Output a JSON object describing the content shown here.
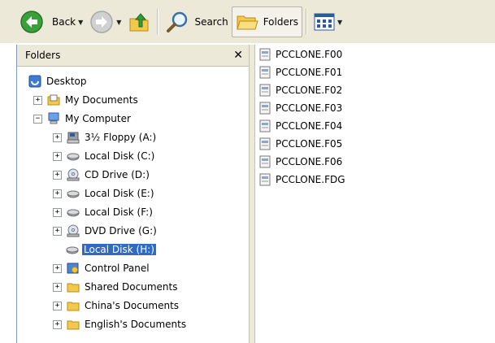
{
  "toolbar": {
    "back_label": "Back",
    "search_label": "Search",
    "folders_label": "Folders"
  },
  "tree": {
    "header": "Folders",
    "desktop": "Desktop",
    "my_documents": "My Documents",
    "my_computer": "My Computer",
    "floppy": "3½ Floppy (A:)",
    "disk_c": "Local Disk (C:)",
    "cd_d": "CD Drive (D:)",
    "disk_e": "Local Disk (E:)",
    "disk_f": "Local Disk (F:)",
    "dvd_g": "DVD Drive (G:)",
    "disk_h": "Local Disk (H:)",
    "control_panel": "Control Panel",
    "shared_docs": "Shared Documents",
    "china_docs": "China's Documents",
    "english_docs": "English's Documents"
  },
  "files": [
    "PCCLONE.F00",
    "PCCLONE.F01",
    "PCCLONE.F02",
    "PCCLONE.F03",
    "PCCLONE.F04",
    "PCCLONE.F05",
    "PCCLONE.F06",
    "PCCLONE.FDG"
  ],
  "colors": {
    "selection": "#316ac5",
    "chrome": "#ece9d8",
    "back_green": "#3aa13a"
  }
}
